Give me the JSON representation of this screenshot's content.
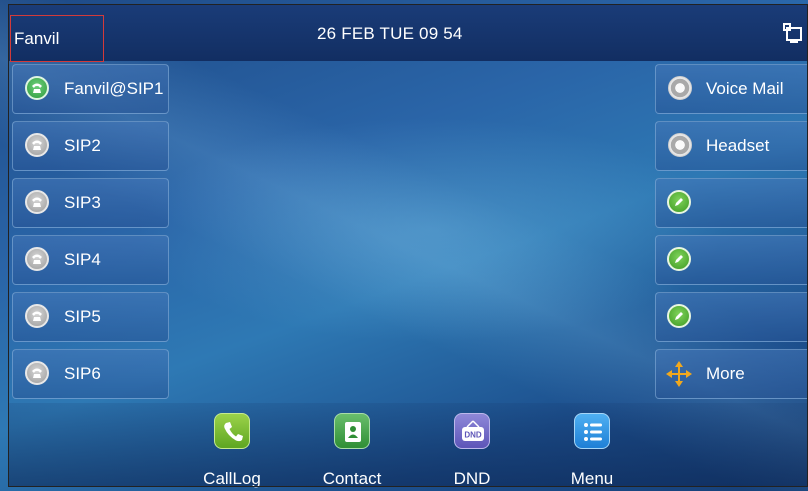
{
  "status_bar": {
    "account": "Fanvil",
    "datetime": "26 FEB TUE 09 54",
    "network_icon": "network-icon"
  },
  "lines": [
    {
      "label": "Fanvil@SIP1",
      "status": "registered",
      "icon": "phone-icon"
    },
    {
      "label": "SIP2",
      "status": "idle",
      "icon": "phone-icon"
    },
    {
      "label": "SIP3",
      "status": "idle",
      "icon": "phone-icon"
    },
    {
      "label": "SIP4",
      "status": "idle",
      "icon": "phone-icon"
    },
    {
      "label": "SIP5",
      "status": "idle",
      "icon": "phone-icon"
    },
    {
      "label": "SIP6",
      "status": "idle",
      "icon": "phone-icon"
    }
  ],
  "dss_keys": [
    {
      "label": "Voice Mail",
      "icon": "voicemail-icon"
    },
    {
      "label": "Headset",
      "icon": "headset-icon"
    },
    {
      "label": "",
      "icon": "edit-icon"
    },
    {
      "label": "",
      "icon": "edit-icon"
    },
    {
      "label": "",
      "icon": "edit-icon"
    },
    {
      "label": "More",
      "icon": "more-arrows-icon"
    }
  ],
  "dock": [
    {
      "label": "CallLog",
      "icon": "calllog-icon"
    },
    {
      "label": "Contact",
      "icon": "contact-icon"
    },
    {
      "label": "DND",
      "icon": "dnd-icon",
      "icon_text": "DND"
    },
    {
      "label": "Menu",
      "icon": "menu-icon"
    }
  ],
  "colors": {
    "background": "#2a65a8",
    "topbar": "#163670",
    "registered_green": "#2f9a3e",
    "selection_border": "#d23a3a"
  }
}
